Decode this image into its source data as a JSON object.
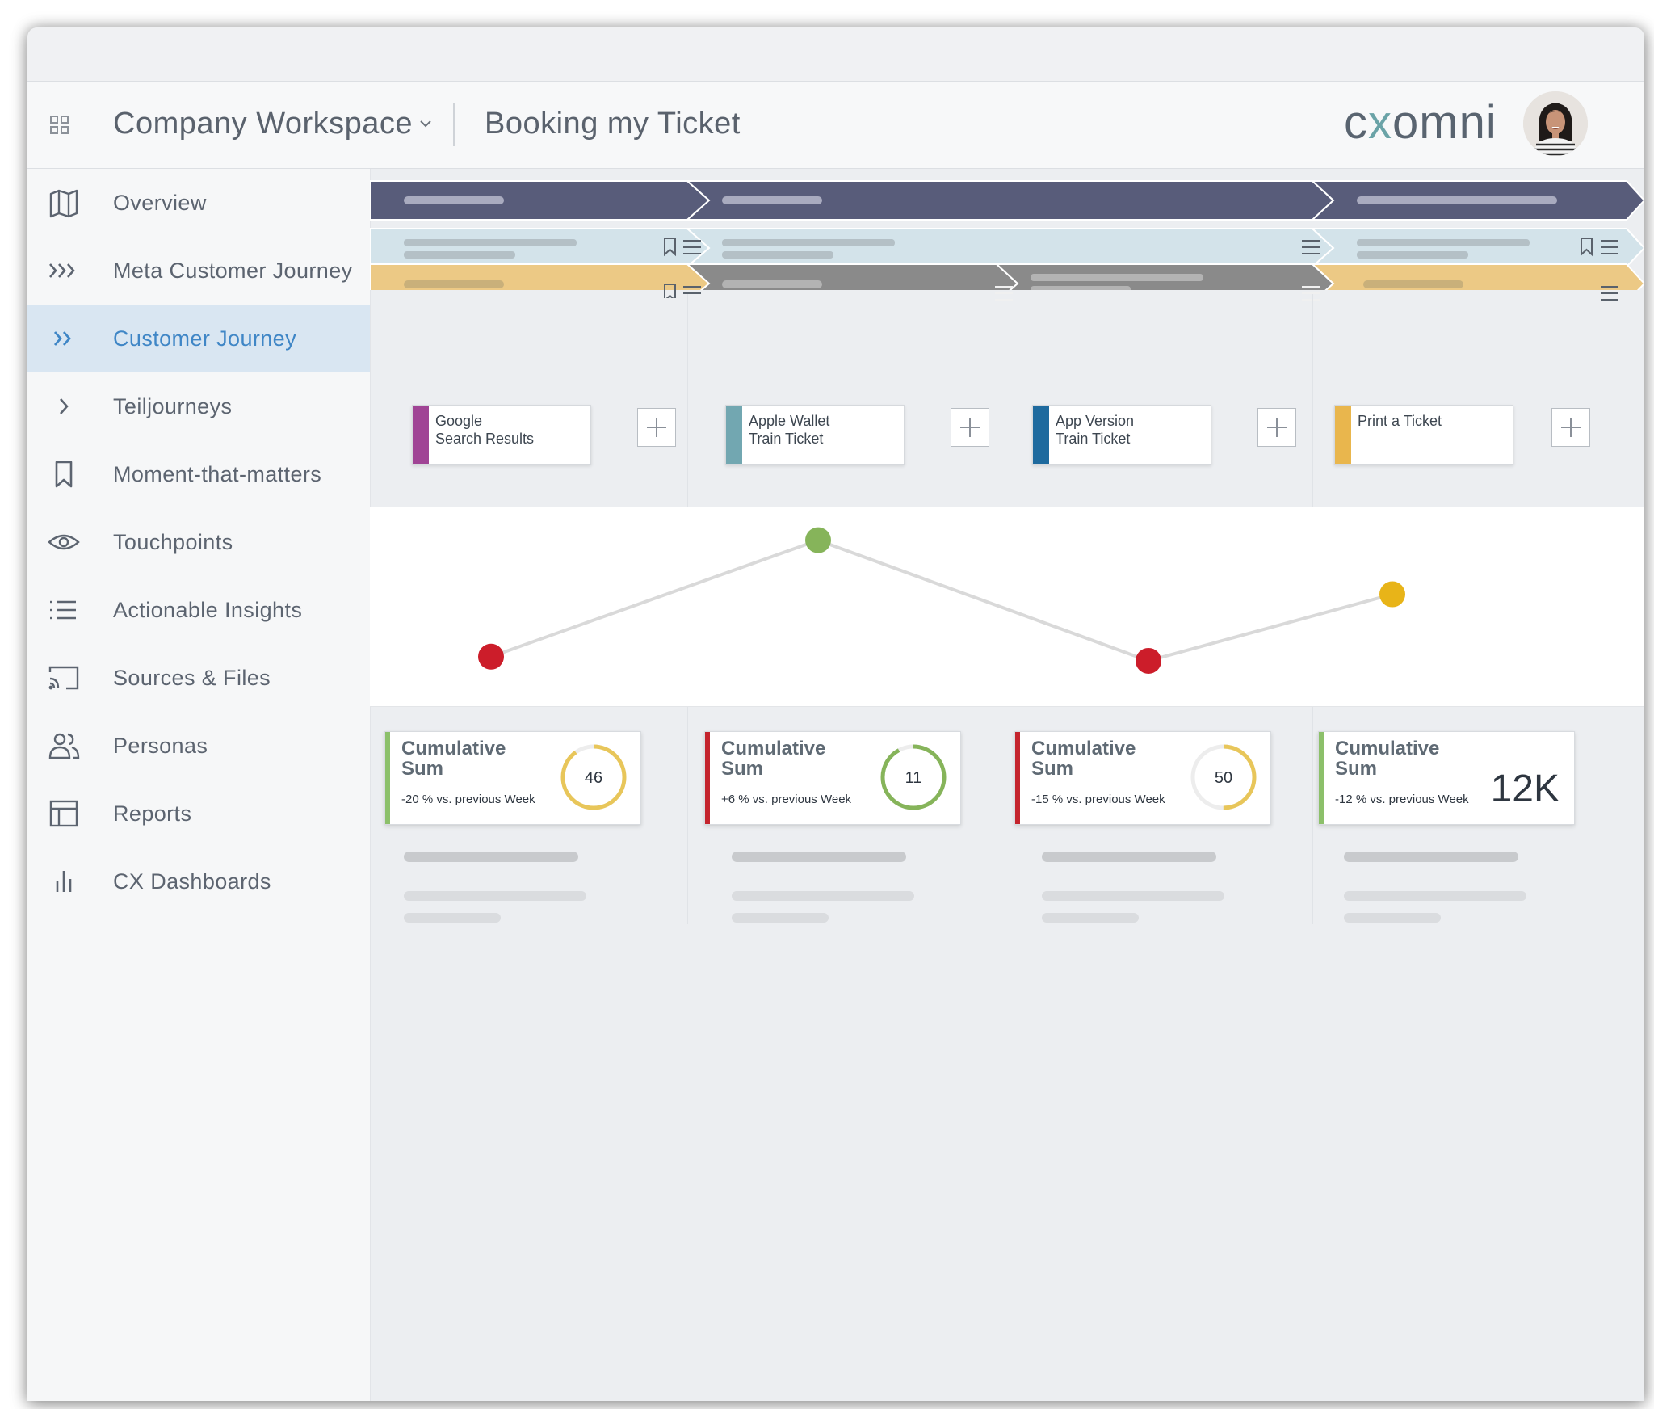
{
  "header": {
    "workspace_title": "Company Workspace",
    "page_title": "Booking my Ticket",
    "logo": {
      "prefix": "c",
      "x": "x",
      "suffix": "omni"
    },
    "avatar_alt": "user-avatar"
  },
  "sidebar": {
    "active": "Customer Journey",
    "items": [
      {
        "label": "Overview",
        "icon": "map-icon"
      },
      {
        "label": "Meta Customer Journey",
        "icon": "triple-chevron-icon"
      },
      {
        "label": "Customer Journey",
        "icon": "double-chevron-icon"
      },
      {
        "label": "Teiljourneys",
        "icon": "chevron-right-icon"
      },
      {
        "label": "Moment-that-matters",
        "icon": "bookmark-icon"
      },
      {
        "label": "Touchpoints",
        "icon": "eye-icon"
      },
      {
        "label": "Actionable Insights",
        "icon": "list-icon"
      },
      {
        "label": "Sources & Files",
        "icon": "cast-icon"
      },
      {
        "label": "Personas",
        "icon": "users-icon"
      },
      {
        "label": "Reports",
        "icon": "table-icon"
      },
      {
        "label": "CX Dashboards",
        "icon": "bar-chart-icon"
      }
    ]
  },
  "touchpoints": [
    {
      "line1": "Google",
      "line2": "Search Results",
      "color": "#a04495"
    },
    {
      "line1": "Apple Wallet",
      "line2": "Train Ticket",
      "color": "#72a7b1"
    },
    {
      "line1": "App Version",
      "line2": "Train Ticket",
      "color": "#1e6a9e"
    },
    {
      "line1": "Print a Ticket",
      "line2": "",
      "color": "#e9b64d"
    }
  ],
  "chart_data": {
    "type": "line",
    "x": [
      "Google Search Results",
      "Apple Wallet Train Ticket",
      "App Version Train Ticket",
      "Print a Ticket"
    ],
    "series": [
      {
        "values": [
          -0.6,
          0.8,
          -0.65,
          0.15
        ],
        "point_colors": [
          "#cc1d2a",
          "#86b45a",
          "#cc1d2a",
          "#e8b418"
        ]
      }
    ],
    "ylim": [
      -1,
      1
    ],
    "line_color": "#d9d9d9"
  },
  "kpis": [
    {
      "title": "Cumulative Sum",
      "delta": "-20 % vs. previous Week",
      "value": "46",
      "display": "gauge",
      "accent": "#8cc06a",
      "ring_color": "#e8c65a",
      "ring_fraction": 0.9
    },
    {
      "title": "Cumulative Sum",
      "delta": "+6 % vs. previous Week",
      "value": "11",
      "display": "gauge",
      "accent": "#c4242d",
      "ring_color": "#86b45a",
      "ring_fraction": 0.92
    },
    {
      "title": "Cumulative Sum",
      "delta": "-15 % vs. previous Week",
      "value": "50",
      "display": "gauge",
      "accent": "#c4242d",
      "ring_color": "#e8c65a",
      "ring_fraction": 0.5
    },
    {
      "title": "Cumulative Sum",
      "delta": "-12 % vs. previous Week",
      "value": "12K",
      "display": "big",
      "accent": "#8cc06a"
    }
  ],
  "colors": {
    "stage_row": "#585c7a",
    "phase_row": "#d3e3ea",
    "sub_row_yellow": "#ecc985",
    "sub_row_grey": "#8a8a8a",
    "accent_blue": "#3f86c6"
  }
}
